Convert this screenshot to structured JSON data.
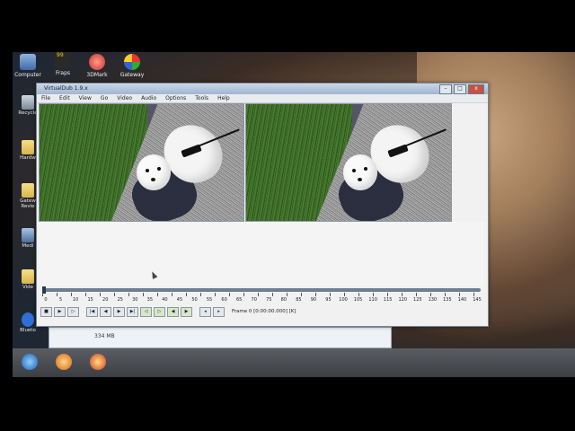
{
  "desktop": {
    "top_icons": [
      {
        "label": "Computer",
        "icon": "computer-icon"
      },
      {
        "label": "Fraps",
        "icon": "fraps-icon",
        "badge": "99"
      },
      {
        "label": "3DMark",
        "icon": "3dmark-icon"
      },
      {
        "label": "Gateway",
        "icon": "gateway-icon"
      }
    ],
    "left_icons": [
      {
        "label": "Recycle",
        "icon": "recycle-bin-icon"
      },
      {
        "label": "Hardw",
        "icon": "folder-icon"
      },
      {
        "label": "Gatew Revie",
        "icon": "folder-icon"
      },
      {
        "label": "Medi",
        "icon": "media-icon"
      },
      {
        "label": "Vide",
        "icon": "video-icon"
      },
      {
        "label": "Blueto",
        "icon": "bluetooth-icon"
      }
    ],
    "behind_window_text": "334 MB"
  },
  "window": {
    "title": "VirtualDub 1.9.x",
    "menu": [
      "File",
      "Edit",
      "View",
      "Go",
      "Video",
      "Audio",
      "Options",
      "Tools",
      "Help"
    ],
    "controls": {
      "minimize": "–",
      "maximize": "□",
      "close": "x"
    },
    "timeline_ticks": [
      "0",
      "5",
      "10",
      "15",
      "20",
      "25",
      "30",
      "35",
      "40",
      "45",
      "50",
      "55",
      "60",
      "65",
      "70",
      "75",
      "80",
      "85",
      "90",
      "95",
      "100",
      "105",
      "110",
      "115",
      "120",
      "125",
      "130",
      "135",
      "140",
      "145"
    ],
    "frame_status": "Frame 0 [0:00:00.000] [K]",
    "toolbar_buttons": [
      "stop",
      "play-input",
      "play-output",
      "prev-frame",
      "back",
      "next",
      "forward",
      "end",
      "prev-key",
      "next-key",
      "mark-in",
      "mark-out",
      "scene-prev",
      "scene-next"
    ]
  }
}
